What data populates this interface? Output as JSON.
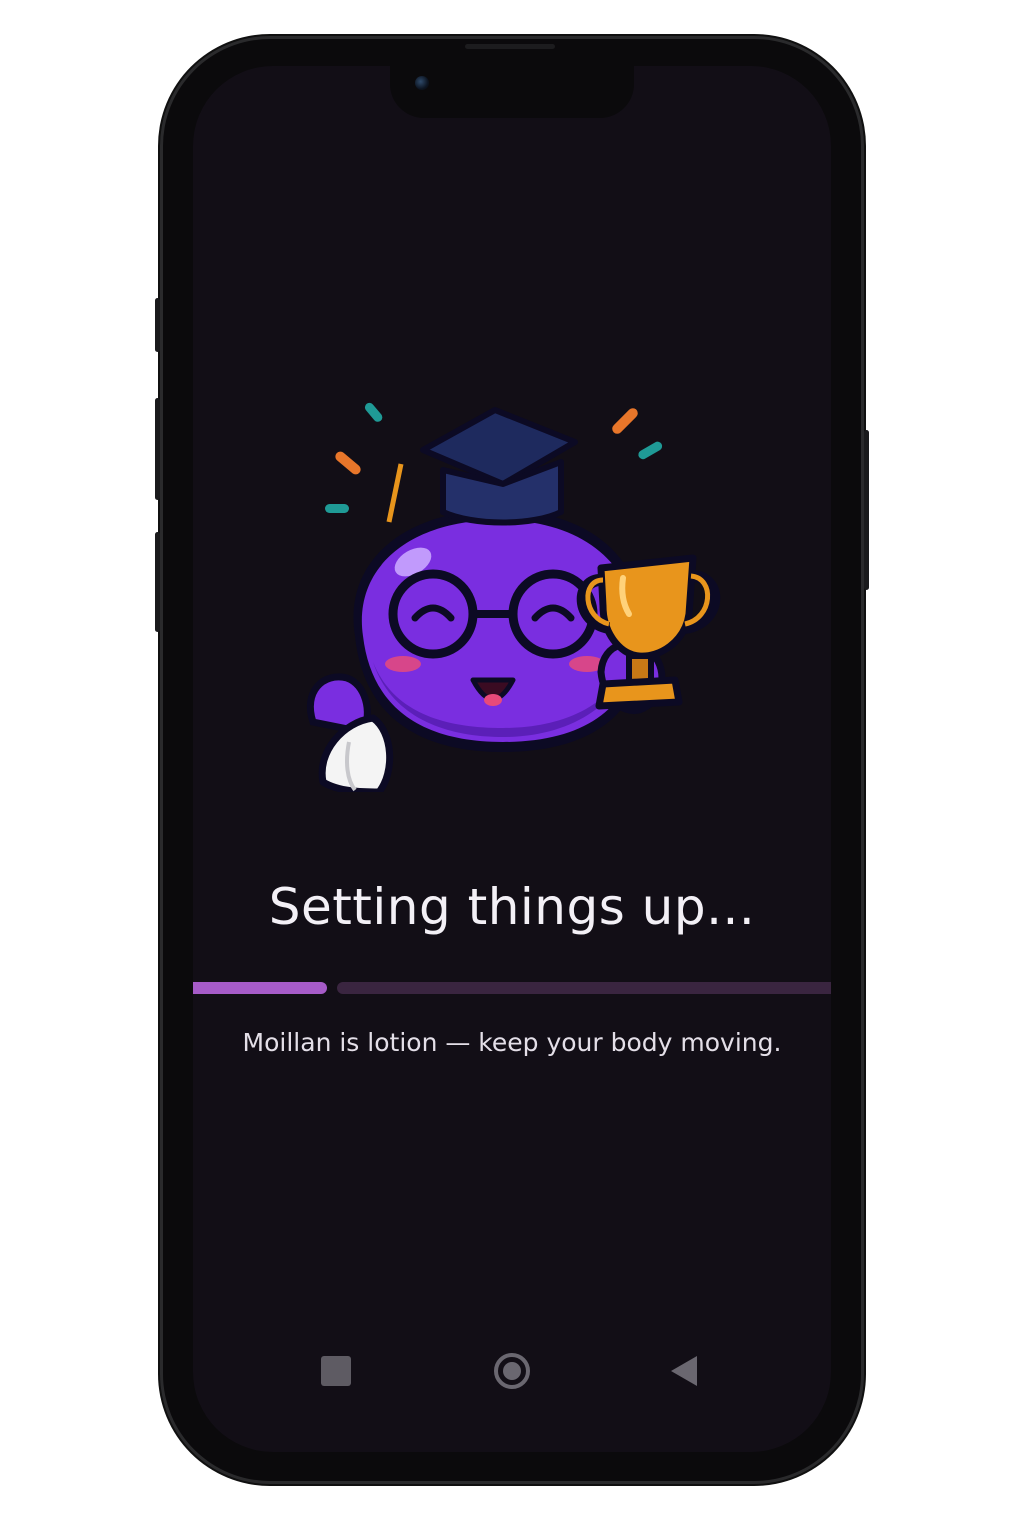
{
  "app": {
    "loading_title": "Setting things up...",
    "tagline": "Moillan is lotion — keep your body moving.",
    "progress": 0.21
  },
  "colors": {
    "background": "#120e16",
    "progress_fill": "#a65bc8",
    "progress_track": "#3a2540",
    "mascot_body": "#7a2ee0",
    "trophy": "#e8951c"
  },
  "navbar": {
    "recents_icon": "square-icon",
    "home_icon": "circle-home-icon",
    "back_icon": "triangle-back-icon"
  },
  "mascot": {
    "icon": "graduate-mascot-with-trophy"
  }
}
